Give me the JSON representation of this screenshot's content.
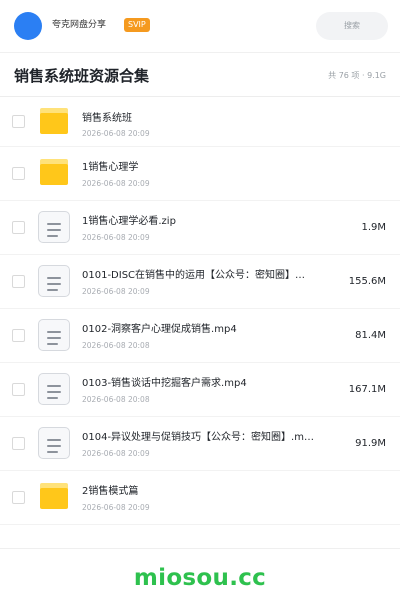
{
  "header": {
    "username": "夸克网盘分享",
    "badge": "SVIP",
    "search_placeholder": "搜索"
  },
  "collection": {
    "title": "销售系统班资源合集",
    "summary": "共 76 项 · 9.1G"
  },
  "files": [
    {
      "type": "folder",
      "name": "销售系统班",
      "date": "2026-06-08 20:09",
      "size": ""
    },
    {
      "type": "folder",
      "name": "1销售心理学",
      "date": "2026-06-08 20:09",
      "size": ""
    },
    {
      "type": "file",
      "name": "1销售心理学必看.zip",
      "date": "2026-06-08 20:09",
      "size": "1.9M"
    },
    {
      "type": "file",
      "name": "0101-DISC在销售中的运用【公众号：密知圈】…",
      "date": "2026-06-08 20:09",
      "size": "155.6M"
    },
    {
      "type": "file",
      "name": "0102-洞察客户心理促成销售.mp4",
      "date": "2026-06-08 20:08",
      "size": "81.4M"
    },
    {
      "type": "file",
      "name": "0103-销售谈话中挖掘客户需求.mp4",
      "date": "2026-06-08 20:08",
      "size": "167.1M"
    },
    {
      "type": "file",
      "name": "0104-异议处理与促销技巧【公众号：密知圈】.m…",
      "date": "2026-06-08 20:09",
      "size": "91.9M"
    },
    {
      "type": "folder",
      "name": "2销售模式篇",
      "date": "2026-06-08 20:09",
      "size": ""
    }
  ],
  "watermark": "miosou.cc",
  "colors": {
    "accent_blue": "#2b7ff3",
    "svip_orange": "#f59a1f",
    "folder_yellow": "#ffc71a",
    "watermark_green": "#2ec14e"
  },
  "icons": {
    "folder": "folder-icon",
    "file": "document-icon"
  }
}
